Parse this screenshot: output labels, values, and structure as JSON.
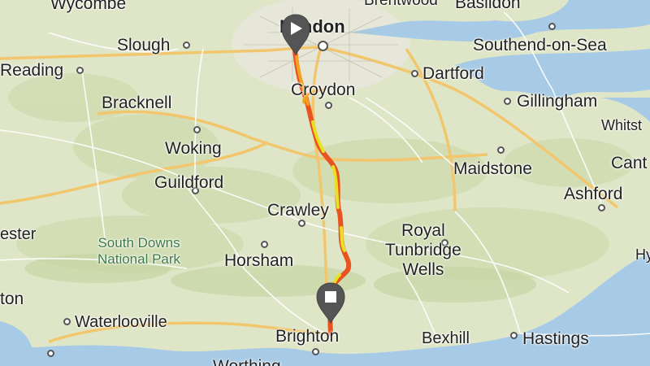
{
  "map": {
    "places": {
      "wycombe": "Wycombe",
      "brentwood": "Brentwood",
      "basildon": "Basildon",
      "london": "London",
      "slough": "Slough",
      "southend": "Southend-on-Sea",
      "reading": "Reading",
      "dartford": "Dartford",
      "croydon": "Croydon",
      "bracknell": "Bracknell",
      "gillingham": "Gillingham",
      "whitstable": "Whitst",
      "woking": "Woking",
      "maidstone": "Maidstone",
      "canterbury": "Cant",
      "guildford": "Guildford",
      "ashford": "Ashford",
      "crawley": "Crawley",
      "chichester": "ester",
      "royal_tunbridge_wells": "Royal Tunbridge Wells",
      "royal_line1": "Royal",
      "royal_line2": "Tunbridge",
      "royal_line3": "Wells",
      "south_downs_line1": "South Downs",
      "south_downs_line2": "National Park",
      "horsham": "Horsham",
      "portsmouth": "ton",
      "waterlooville": "Waterlooville",
      "brighton": "Brighton",
      "bexhill": "Bexhill",
      "hastings": "Hastings",
      "hythe": "Hy",
      "worthing": "Worthing"
    },
    "route": {
      "start_marker_icon": "play-icon",
      "end_marker_icon": "stop-icon",
      "colors": {
        "hot": "#e8531f",
        "warm": "#f4a11f",
        "cool": "#e8e020"
      }
    },
    "colors": {
      "land": "#dfe6c8",
      "sea": "#a7cbe6",
      "motorway": "#f2c66d",
      "road": "#ffffff"
    }
  }
}
